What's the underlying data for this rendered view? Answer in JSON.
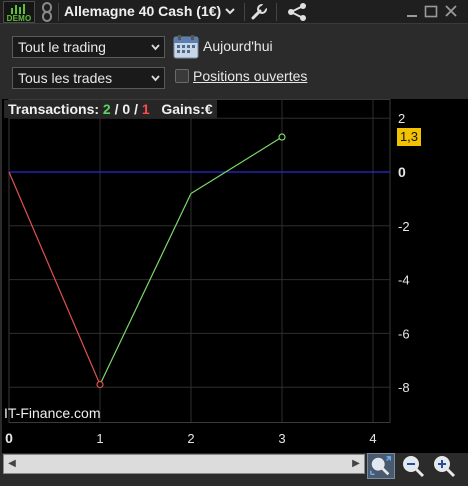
{
  "titlebar": {
    "demo_label": "DEMO",
    "instrument": "Allemagne 40 Cash (1€)",
    "icons": [
      "demo-bars-icon",
      "link-icon",
      "chevron-down-icon",
      "wrench-icon",
      "share-icon",
      "minimize-icon",
      "maximize-icon",
      "close-icon"
    ]
  },
  "filters": {
    "period": "Tout le trading",
    "trades": "Tous les trades",
    "today_label": "Aujourd'hui",
    "open_positions_label": "Positions ouvertes",
    "open_positions_checked": false
  },
  "stats": {
    "transactions_label": "Transactions:",
    "wins": "2",
    "sep1": " / ",
    "neutral": "0",
    "sep2": " / ",
    "losses": "1",
    "gains_label": "Gains:",
    "gains_unit": "€"
  },
  "watermark": "IT-Finance.com",
  "colors": {
    "up": "#7cd96a",
    "down": "#e0524f",
    "zero_line": "#2a2ad8",
    "grid": "#2e2e2e",
    "last_badge": "#f2c200"
  },
  "chart_data": {
    "type": "line",
    "x": [
      0,
      1,
      2,
      3
    ],
    "y": [
      0,
      -7.9,
      -0.8,
      1.3
    ],
    "xlim": [
      0,
      4.1
    ],
    "ylim": [
      -9,
      2.5
    ],
    "x_ticks": [
      "0",
      "1",
      "2",
      "3",
      "4"
    ],
    "y_ticks": [
      "2",
      "0",
      "-2",
      "-4",
      "-6",
      "-8"
    ],
    "reference_line": 0,
    "last_value_label": "1,3",
    "grid": true
  }
}
